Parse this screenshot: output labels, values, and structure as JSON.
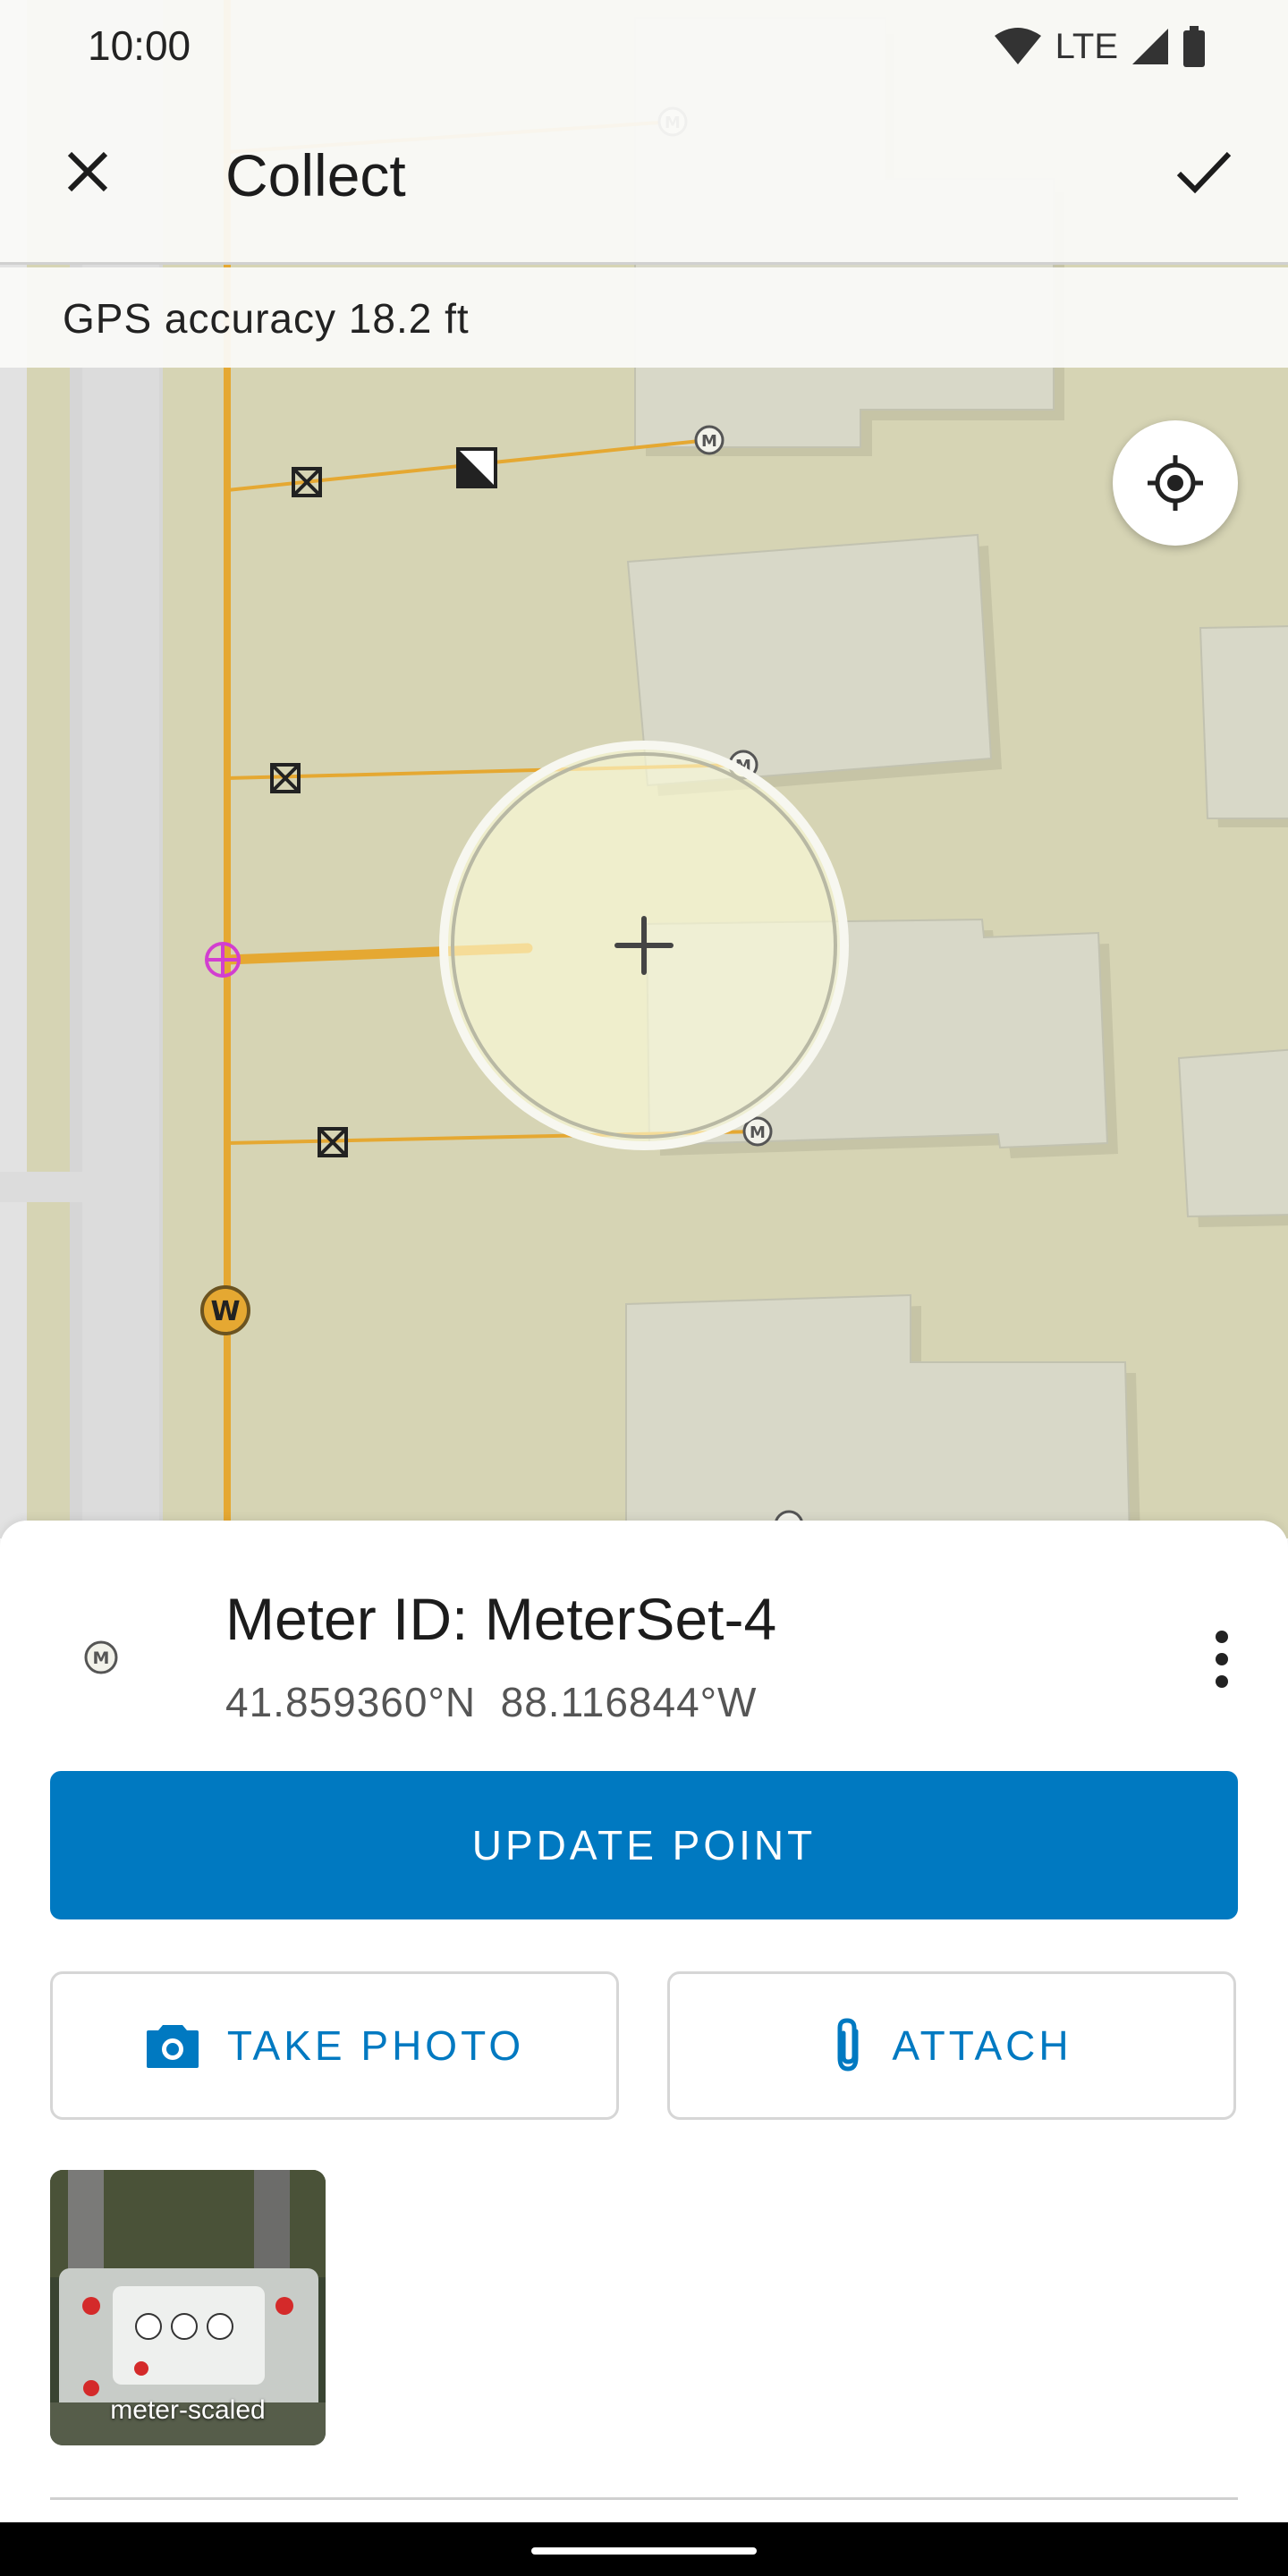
{
  "status_bar": {
    "time": "10:00",
    "network": "LTE",
    "icons": [
      "wifi-icon",
      "cell-signal-icon",
      "battery-icon"
    ]
  },
  "app_bar": {
    "title": "Collect",
    "close_icon": "close-icon",
    "confirm_icon": "check-icon"
  },
  "gps": {
    "accuracy_text": "GPS accuracy 18.2 ft"
  },
  "map": {
    "locate_icon": "my-location-icon",
    "crosshair_icon": "crosshair-icon",
    "marker_labels": [
      "M",
      "W"
    ]
  },
  "feature": {
    "title": "Meter ID: MeterSet-4",
    "coordinates": "41.859360°N  88.116844°W",
    "icon": "meter-icon",
    "menu_icon": "more-vert-icon"
  },
  "actions": {
    "update_label": "UPDATE POINT",
    "take_photo_label": "TAKE PHOTO",
    "attach_label": "ATTACH",
    "take_photo_icon": "camera-icon",
    "attach_icon": "paperclip-icon"
  },
  "attachments": [
    {
      "label": "meter-scaled"
    }
  ],
  "colors": {
    "accent": "#0079c1",
    "map_bg": "#d6d4b4",
    "building": "#d8d8c8",
    "service_line": "#e5a832",
    "road": "#d7d7d7"
  }
}
